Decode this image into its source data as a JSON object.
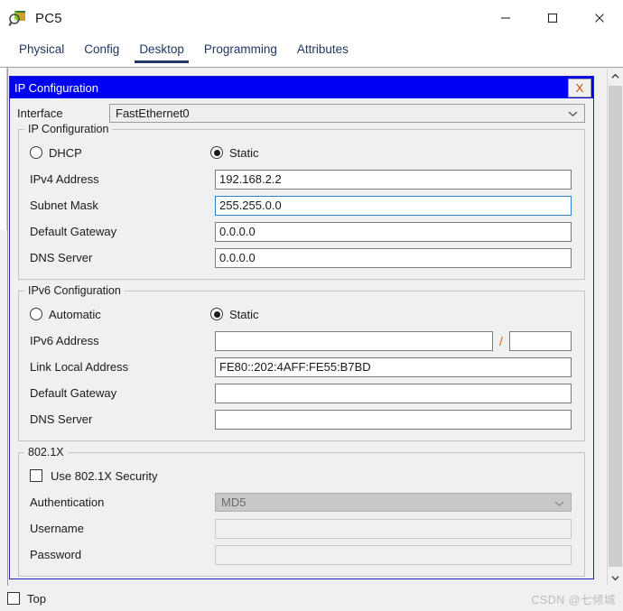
{
  "window": {
    "title": "PC5",
    "icon": "packet-tracer-device-icon",
    "controls": {
      "minimize": "minimize-icon",
      "maximize": "maximize-icon",
      "close": "close-icon"
    }
  },
  "tabs": [
    {
      "label": "Physical",
      "active": false
    },
    {
      "label": "Config",
      "active": false
    },
    {
      "label": "Desktop",
      "active": true
    },
    {
      "label": "Programming",
      "active": false
    },
    {
      "label": "Attributes",
      "active": false
    }
  ],
  "ip_window": {
    "title": "IP Configuration",
    "close_label": "X",
    "interface": {
      "label": "Interface",
      "value": "FastEthernet0",
      "chevron": "chevron-down-icon"
    },
    "ipv4": {
      "legend": "IP Configuration",
      "modes": [
        {
          "label": "DHCP",
          "selected": false
        },
        {
          "label": "Static",
          "selected": true
        }
      ],
      "fields": [
        {
          "label": "IPv4 Address",
          "value": "192.168.2.2",
          "focused": false
        },
        {
          "label": "Subnet Mask",
          "value": "255.255.0.0",
          "focused": true
        },
        {
          "label": "Default Gateway",
          "value": "0.0.0.0",
          "focused": false
        },
        {
          "label": "DNS Server",
          "value": "0.0.0.0",
          "focused": false
        }
      ]
    },
    "ipv6": {
      "legend": "IPv6 Configuration",
      "modes": [
        {
          "label": "Automatic",
          "selected": false
        },
        {
          "label": "Static",
          "selected": true
        }
      ],
      "address_row": {
        "label": "IPv6 Address",
        "value": "",
        "separator": "/",
        "prefix_value": ""
      },
      "fields": [
        {
          "label": "Link Local Address",
          "value": "FE80::202:4AFF:FE55:B7BD"
        },
        {
          "label": "Default Gateway",
          "value": ""
        },
        {
          "label": "DNS Server",
          "value": ""
        }
      ]
    },
    "dot1x": {
      "legend": "802.1X",
      "use_security": {
        "label": "Use 802.1X Security",
        "checked": false
      },
      "authentication": {
        "label": "Authentication",
        "value": "MD5",
        "disabled": true
      },
      "username": {
        "label": "Username",
        "value": "",
        "disabled": true
      },
      "password": {
        "label": "Password",
        "value": "",
        "disabled": true
      }
    }
  },
  "footer": {
    "top_checkbox": {
      "label": "Top",
      "checked": false
    },
    "watermark": "CSDN @七倾城"
  },
  "colors": {
    "title_bar_blue": "#0000f5",
    "tab_navy": "#1f3864",
    "panel_grey": "#f0f0f0",
    "focus_blue": "#2f7fd0",
    "disabled_grey": "#c8c8c8"
  }
}
